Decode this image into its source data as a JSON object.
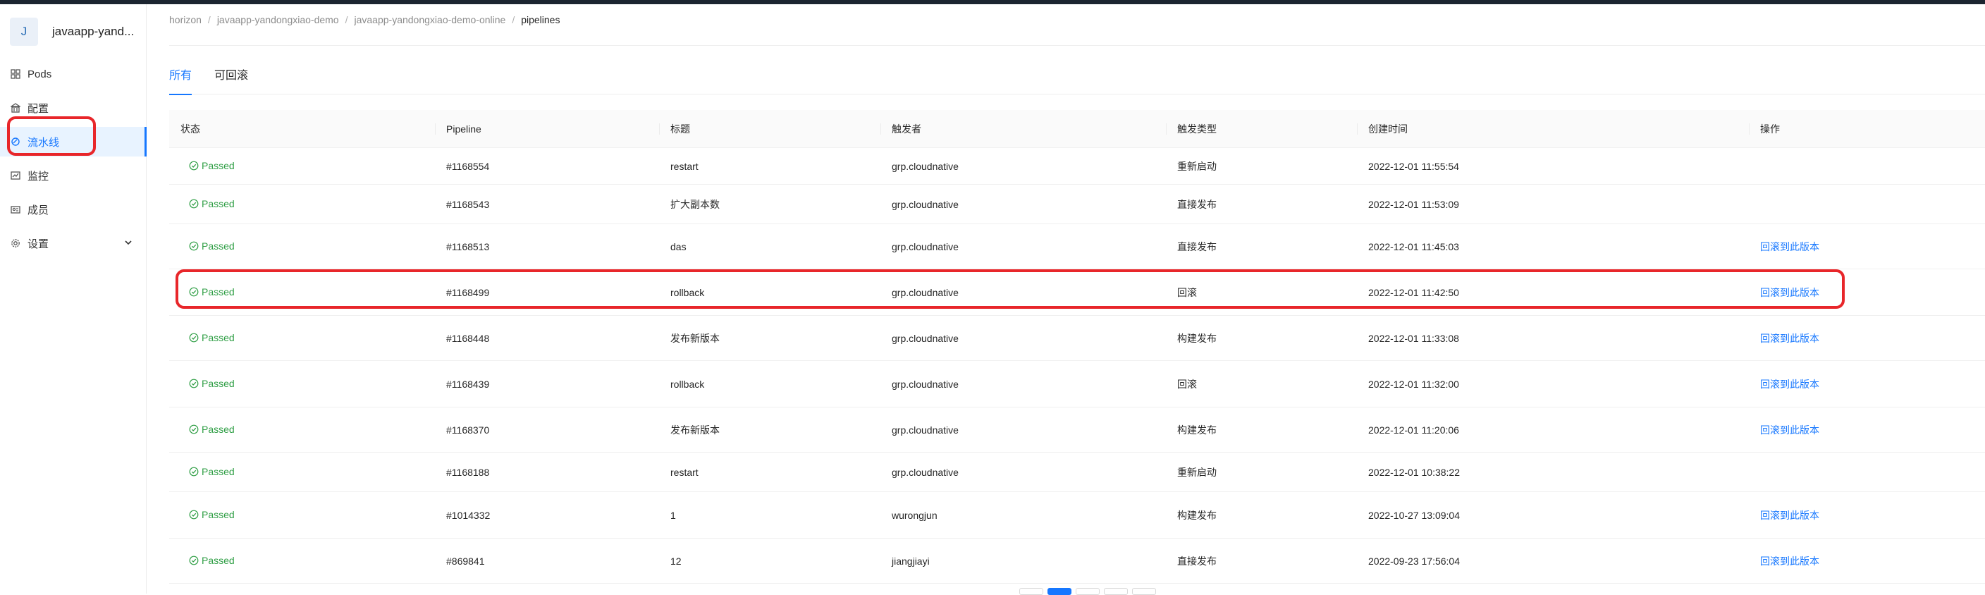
{
  "app": {
    "avatar_letter": "J",
    "name": "javaapp-yand..."
  },
  "sidebar": {
    "items": [
      {
        "label": "Pods",
        "icon": "pods-icon"
      },
      {
        "label": "配置",
        "icon": "config-icon"
      },
      {
        "label": "流水线",
        "icon": "pipeline-icon",
        "active": true
      },
      {
        "label": "监控",
        "icon": "monitor-icon"
      },
      {
        "label": "成员",
        "icon": "members-icon"
      },
      {
        "label": "设置",
        "icon": "settings-icon",
        "expandable": true
      }
    ]
  },
  "breadcrumb": {
    "items": [
      "horizon",
      "javaapp-yandongxiao-demo",
      "javaapp-yandongxiao-demo-online"
    ],
    "current": "pipelines",
    "separator": "/"
  },
  "tabs": [
    {
      "label": "所有",
      "active": true
    },
    {
      "label": "可回滚",
      "active": false
    }
  ],
  "table": {
    "columns": [
      "状态",
      "Pipeline",
      "标题",
      "触发者",
      "触发类型",
      "创建时间",
      "操作"
    ],
    "rows": [
      {
        "status": "Passed",
        "pipeline": "#1168554",
        "title": "restart",
        "trigger_by": "grp.cloudnative",
        "trigger_type": "重新启动",
        "created": "2022-12-01 11:55:54",
        "action": ""
      },
      {
        "status": "Passed",
        "pipeline": "#1168543",
        "title": "扩大副本数",
        "trigger_by": "grp.cloudnative",
        "trigger_type": "直接发布",
        "created": "2022-12-01 11:53:09",
        "action": ""
      },
      {
        "status": "Passed",
        "pipeline": "#1168513",
        "title": "das",
        "trigger_by": "grp.cloudnative",
        "trigger_type": "直接发布",
        "created": "2022-12-01 11:45:03",
        "action": "回滚到此版本"
      },
      {
        "status": "Passed",
        "pipeline": "#1168499",
        "title": "rollback",
        "trigger_by": "grp.cloudnative",
        "trigger_type": "回滚",
        "created": "2022-12-01 11:42:50",
        "action": "回滚到此版本"
      },
      {
        "status": "Passed",
        "pipeline": "#1168448",
        "title": "发布新版本",
        "trigger_by": "grp.cloudnative",
        "trigger_type": "构建发布",
        "created": "2022-12-01 11:33:08",
        "action": "回滚到此版本"
      },
      {
        "status": "Passed",
        "pipeline": "#1168439",
        "title": "rollback",
        "trigger_by": "grp.cloudnative",
        "trigger_type": "回滚",
        "created": "2022-12-01 11:32:00",
        "action": "回滚到此版本"
      },
      {
        "status": "Passed",
        "pipeline": "#1168370",
        "title": "发布新版本",
        "trigger_by": "grp.cloudnative",
        "trigger_type": "构建发布",
        "created": "2022-12-01 11:20:06",
        "action": "回滚到此版本"
      },
      {
        "status": "Passed",
        "pipeline": "#1168188",
        "title": "restart",
        "trigger_by": "grp.cloudnative",
        "trigger_type": "重新启动",
        "created": "2022-12-01 10:38:22",
        "action": ""
      },
      {
        "status": "Passed",
        "pipeline": "#1014332",
        "title": "1",
        "trigger_by": "wurongjun",
        "trigger_type": "构建发布",
        "created": "2022-10-27 13:09:04",
        "action": "回滚到此版本"
      },
      {
        "status": "Passed",
        "pipeline": "#869841",
        "title": "12",
        "trigger_by": "jiangjiayi",
        "trigger_type": "直接发布",
        "created": "2022-09-23 17:56:04",
        "action": "回滚到此版本"
      }
    ]
  },
  "colors": {
    "accent": "#1677ff",
    "passed": "#2e9e44",
    "highlight": "#e8262a"
  }
}
